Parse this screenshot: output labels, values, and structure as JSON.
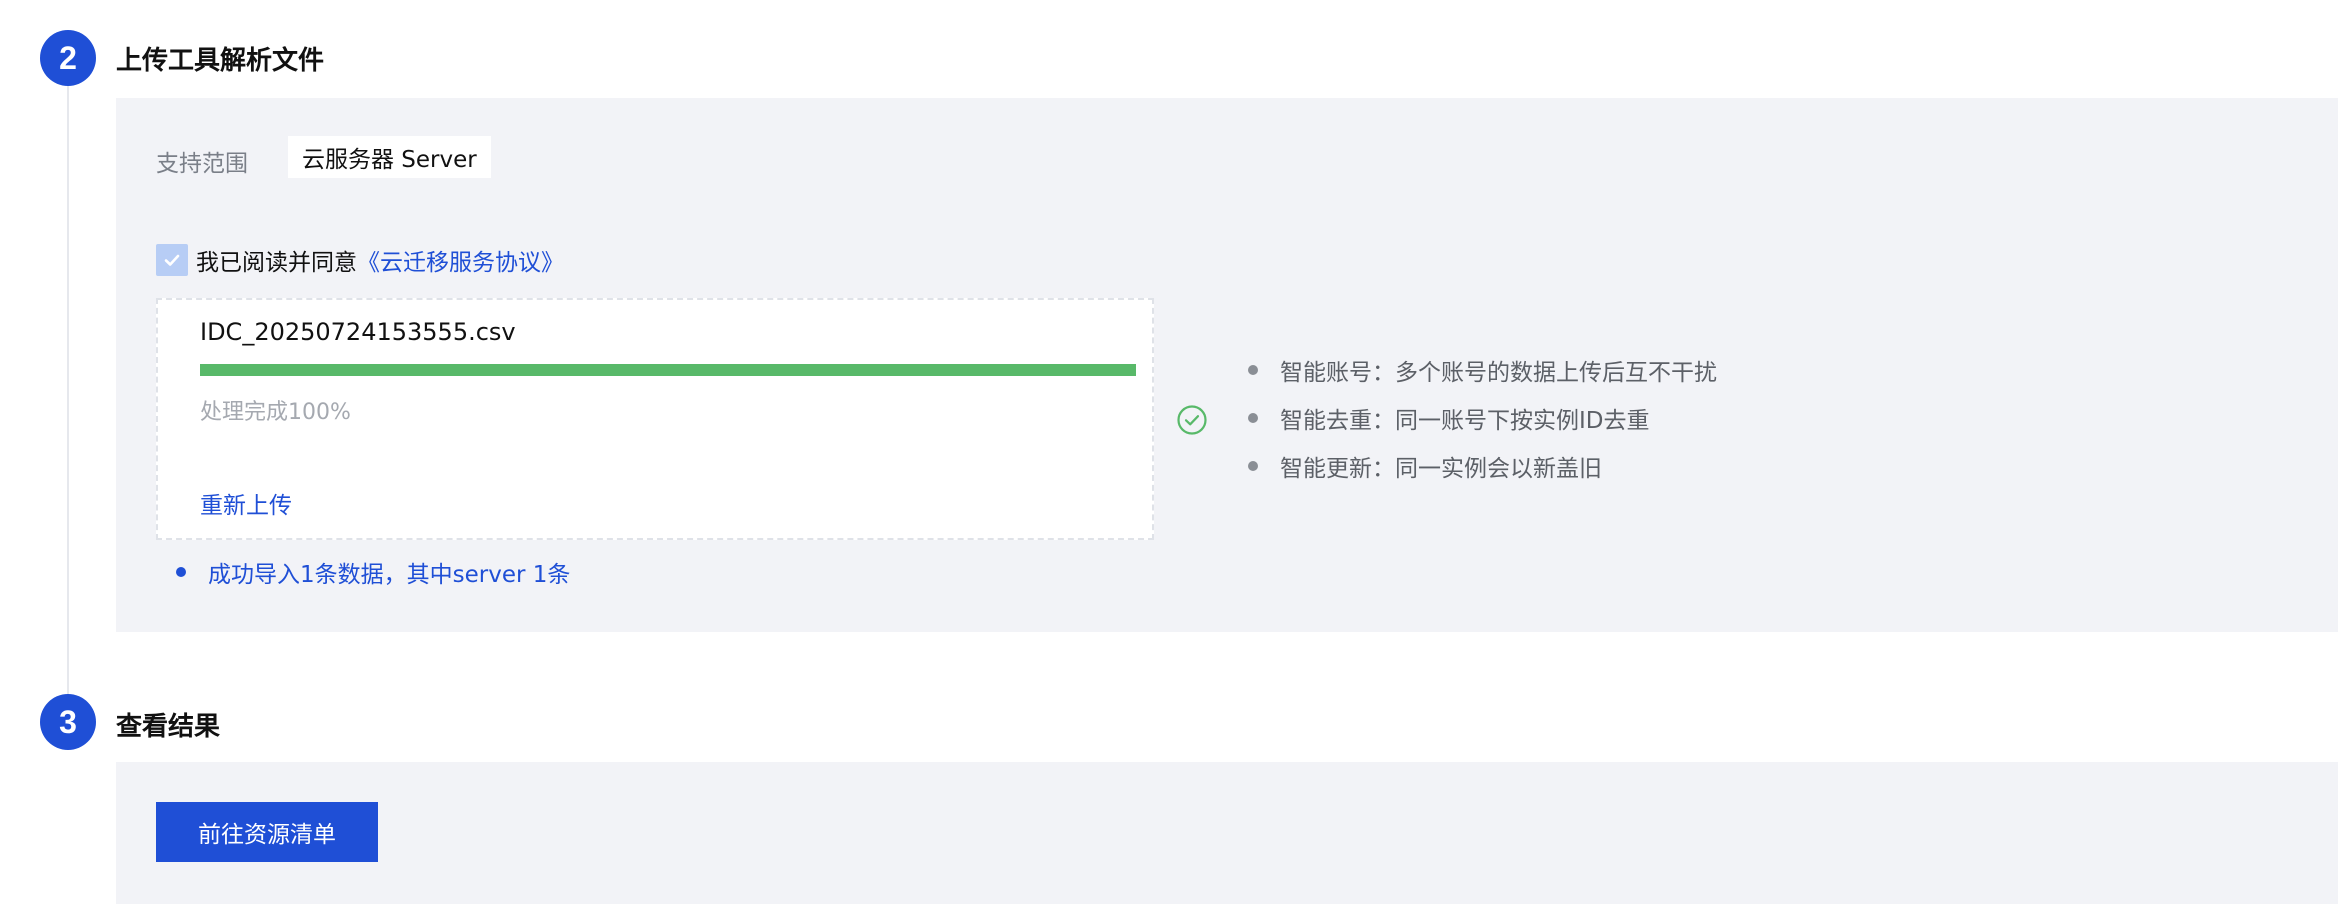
{
  "steps": [
    {
      "number": "2",
      "title": "上传工具解析文件"
    },
    {
      "number": "3",
      "title": "查看结果"
    }
  ],
  "scope": {
    "label": "支持范围",
    "tag": "云服务器 Server"
  },
  "agreement": {
    "checked": true,
    "text": "我已阅读并同意",
    "link": "《云迁移服务协议》"
  },
  "upload": {
    "file_name": "IDC_20250724153555.csv",
    "progress_percent": 100,
    "progress_text": "处理完成100%",
    "reupload_label": "重新上传",
    "status": "success"
  },
  "features": [
    {
      "text": "智能账号：多个账号的数据上传后互不干扰"
    },
    {
      "text": "智能去重：同一账号下按实例ID去重"
    },
    {
      "text": "智能更新：同一实例会以新盖旧"
    }
  ],
  "result": {
    "text": "成功导入1条数据，其中server 1条"
  },
  "actions": {
    "goto_label": "前往资源清单"
  },
  "colors": {
    "accent": "#1f4fd6",
    "progress": "#58b969",
    "panel_bg": "#f2f3f7",
    "success_icon": "#58b969"
  },
  "icons": {
    "checkbox": "check-icon",
    "status": "check-circle-icon"
  }
}
